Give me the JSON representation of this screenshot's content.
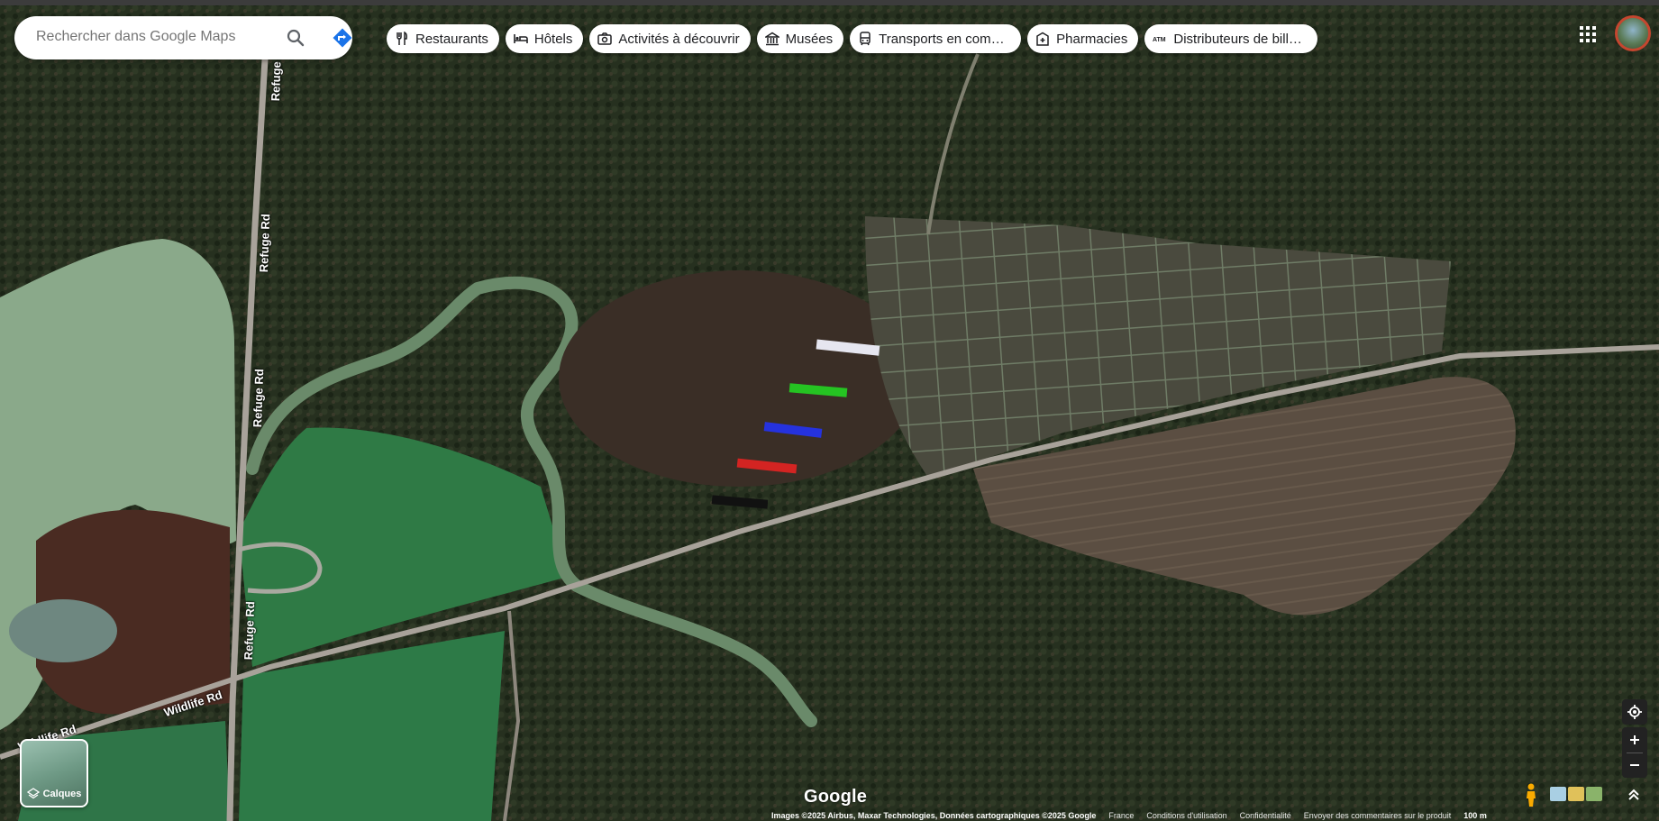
{
  "search": {
    "placeholder": "Rechercher dans Google Maps"
  },
  "chips": [
    {
      "icon": "fork-knife-icon",
      "label": "Restaurants"
    },
    {
      "icon": "bed-icon",
      "label": "Hôtels"
    },
    {
      "icon": "camera-icon",
      "label": "Activités à découvrir"
    },
    {
      "icon": "museum-icon",
      "label": "Musées"
    },
    {
      "icon": "transit-icon",
      "label": "Transports en comm..."
    },
    {
      "icon": "pharmacy-icon",
      "label": "Pharmacies"
    },
    {
      "icon": "atm-icon",
      "label": "Distributeurs de bille..."
    }
  ],
  "map": {
    "type": "satellite",
    "roads": [
      {
        "name": "Refuge Rd"
      },
      {
        "name": "Wildlife Rd"
      }
    ],
    "road_labels": {
      "refuge_1": "Refuge Rd",
      "refuge_2": "Refuge Rd",
      "refuge_3": "Refuge Rd",
      "refuge_4": "Refuge Rd",
      "wildlife_1": "Wildlife Rd",
      "wildlife_2": "Wildlife Rd"
    },
    "markers_colors": [
      "#e6e6f0",
      "#22dd22",
      "#2233ff",
      "#ee2222",
      "#111111"
    ]
  },
  "layers": {
    "label": "Calques"
  },
  "brand": {
    "logo": "Google"
  },
  "footer": {
    "imagery": "Images ©2025 Airbus, Maxar Technologies, Données cartographiques ©2025 Google",
    "region": "France",
    "terms": "Conditions d'utilisation",
    "privacy": "Confidentialité",
    "feedback": "Envoyer des commentaires sur le produit",
    "scale": "100 m"
  },
  "colors": {
    "accent": "#1a73e8",
    "avatar_ring": "#c5462f"
  }
}
